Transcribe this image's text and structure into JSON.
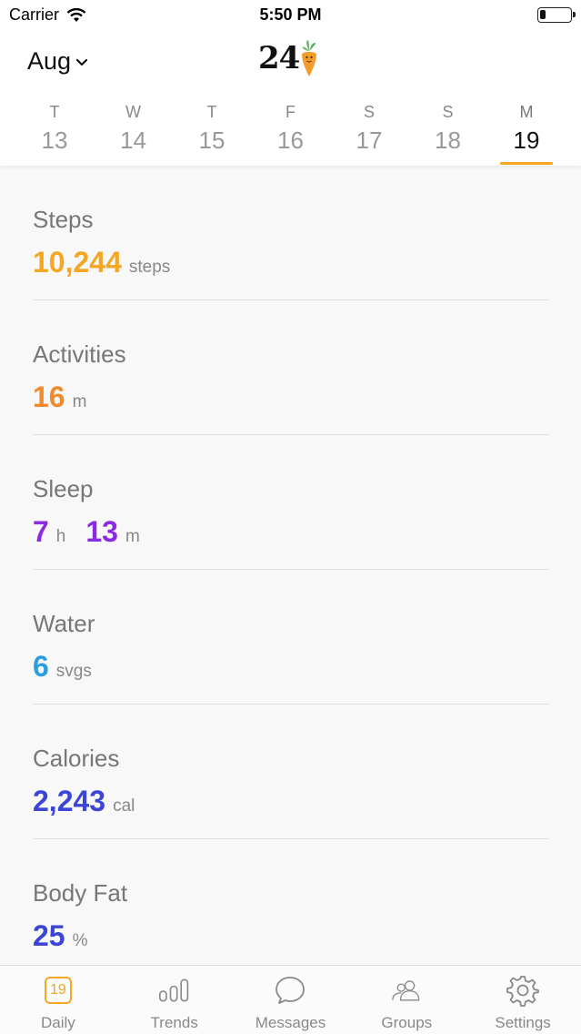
{
  "status_bar": {
    "carrier": "Carrier",
    "time": "5:50 PM",
    "battery_level": 0.2
  },
  "header": {
    "month": "Aug",
    "logo_text": "24",
    "logo_icon": "carrot-icon",
    "week": [
      {
        "letter": "T",
        "num": "13",
        "selected": false
      },
      {
        "letter": "W",
        "num": "14",
        "selected": false
      },
      {
        "letter": "T",
        "num": "15",
        "selected": false
      },
      {
        "letter": "F",
        "num": "16",
        "selected": false
      },
      {
        "letter": "S",
        "num": "17",
        "selected": false
      },
      {
        "letter": "S",
        "num": "18",
        "selected": false
      },
      {
        "letter": "M",
        "num": "19",
        "selected": true
      }
    ],
    "accent_color": "#f5a623"
  },
  "metrics": {
    "steps": {
      "title": "Steps",
      "value": "10,244",
      "unit": "steps",
      "color": "#f5a623"
    },
    "activities": {
      "title": "Activities",
      "value": "16",
      "unit": "m",
      "color": "#f08a2e"
    },
    "sleep": {
      "title": "Sleep",
      "hours": "7",
      "hours_unit": "h",
      "minutes": "13",
      "minutes_unit": "m",
      "color": "#8a2be2"
    },
    "water": {
      "title": "Water",
      "value": "6",
      "unit": "svgs",
      "color": "#2a9fe0"
    },
    "calories": {
      "title": "Calories",
      "value": "2,243",
      "unit": "cal",
      "color": "#3b46d6"
    },
    "body_fat": {
      "title": "Body Fat",
      "value": "25",
      "unit": "%",
      "color": "#3b46d6"
    }
  },
  "tab_bar": {
    "tabs": [
      {
        "label": "Daily",
        "icon": "calendar-icon",
        "badge": "19",
        "active": true
      },
      {
        "label": "Trends",
        "icon": "bar-chart-icon",
        "active": false
      },
      {
        "label": "Messages",
        "icon": "chat-bubble-icon",
        "active": false
      },
      {
        "label": "Groups",
        "icon": "people-icon",
        "active": false
      },
      {
        "label": "Settings",
        "icon": "gear-icon",
        "active": false
      }
    ]
  }
}
